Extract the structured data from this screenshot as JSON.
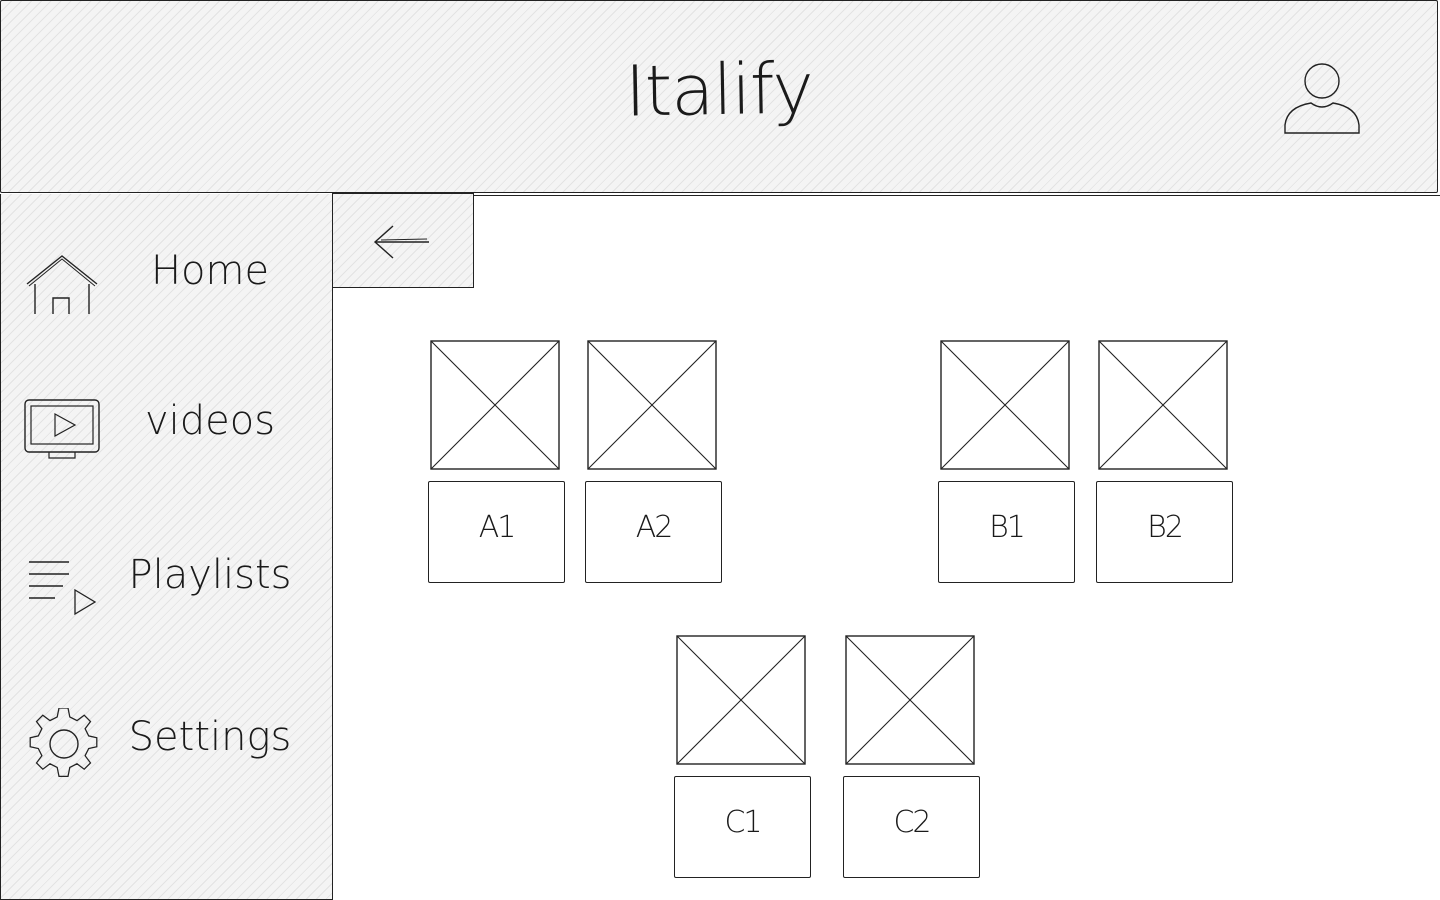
{
  "header": {
    "app_title": "Italify",
    "avatar_icon": "user-avatar-icon"
  },
  "sidebar": {
    "items": [
      {
        "label": "Home",
        "icon": "home-icon"
      },
      {
        "label": "videos",
        "icon": "video-player-icon"
      },
      {
        "label": "Playlists",
        "icon": "playlist-icon"
      },
      {
        "label": "Settings",
        "icon": "gear-icon"
      }
    ]
  },
  "toolbar": {
    "back_icon": "arrow-left-icon"
  },
  "content": {
    "tiles": [
      {
        "label": "A1"
      },
      {
        "label": "A2"
      },
      {
        "label": "B1"
      },
      {
        "label": "B2"
      },
      {
        "label": "C1"
      },
      {
        "label": "C2"
      }
    ]
  },
  "colors": {
    "stroke": "#222222",
    "hatch_background": "#f4f4f4",
    "page_background": "#ffffff"
  }
}
